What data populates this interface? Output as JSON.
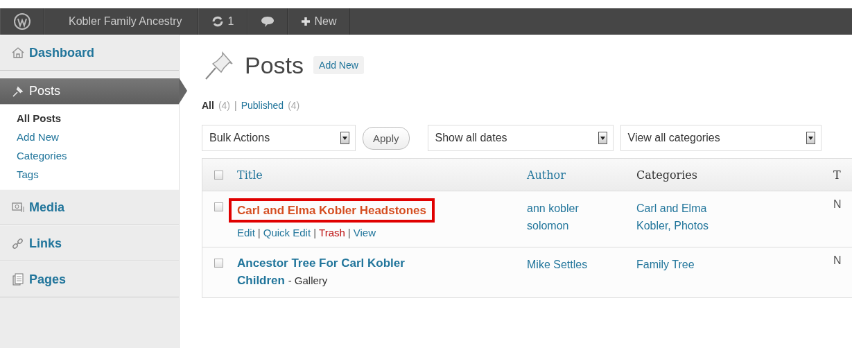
{
  "admin_bar": {
    "items": [
      {
        "kind": "logo"
      },
      {
        "kind": "site",
        "label": "Kobler Family Ancestry"
      },
      {
        "kind": "updates",
        "label": "1"
      },
      {
        "kind": "comments"
      },
      {
        "kind": "new",
        "label": "New"
      }
    ]
  },
  "sidebar": {
    "items": [
      {
        "label": "Dashboard",
        "selected": false
      },
      {
        "label": "Posts",
        "selected": true,
        "children": [
          {
            "label": "All Posts",
            "selected": true
          },
          {
            "label": "Add New",
            "selected": false
          },
          {
            "label": "Categories",
            "selected": false
          },
          {
            "label": "Tags",
            "selected": false
          }
        ]
      },
      {
        "label": "Media",
        "selected": false
      },
      {
        "label": "Links",
        "selected": false
      },
      {
        "label": "Pages",
        "selected": false
      }
    ]
  },
  "page": {
    "title": "Posts",
    "add_button": "Add New"
  },
  "views": {
    "separator": "|",
    "items": [
      {
        "label": "All",
        "count": "(4)",
        "selected": true
      },
      {
        "label": "Published",
        "count": "(4)",
        "selected": false
      }
    ]
  },
  "toolbar": {
    "bulk_select": "Bulk Actions",
    "apply": "Apply",
    "date_select": "Show all dates",
    "category_select": "View all categories"
  },
  "table": {
    "select_all_checked": false,
    "action_separator": "|",
    "columns": [
      {
        "label": "Title",
        "sortable": true
      },
      {
        "label": "Author",
        "sortable": true
      },
      {
        "label": "Categories",
        "sortable": false
      },
      {
        "label": "T",
        "sortable": false
      }
    ],
    "rows": [
      {
        "title": "Carl and Elma Kobler Headstones",
        "hovered": true,
        "highlighted": true,
        "checked": false,
        "actions": [
          {
            "label": "Edit",
            "kind": "normal"
          },
          {
            "label": "Quick Edit",
            "kind": "normal"
          },
          {
            "label": "Trash",
            "kind": "delete"
          },
          {
            "label": "View",
            "kind": "normal"
          }
        ],
        "author": "ann kobler solomon",
        "categories": "Carl and Elma Kobler, Photos",
        "column_4": "N"
      },
      {
        "title": "Ancestor Tree For Carl Kobler Children",
        "hovered": false,
        "highlighted": false,
        "state": "- Gallery",
        "checked": false,
        "actions": [],
        "author": "Mike Settles",
        "categories": "Family Tree",
        "column_4": "N"
      }
    ]
  }
}
